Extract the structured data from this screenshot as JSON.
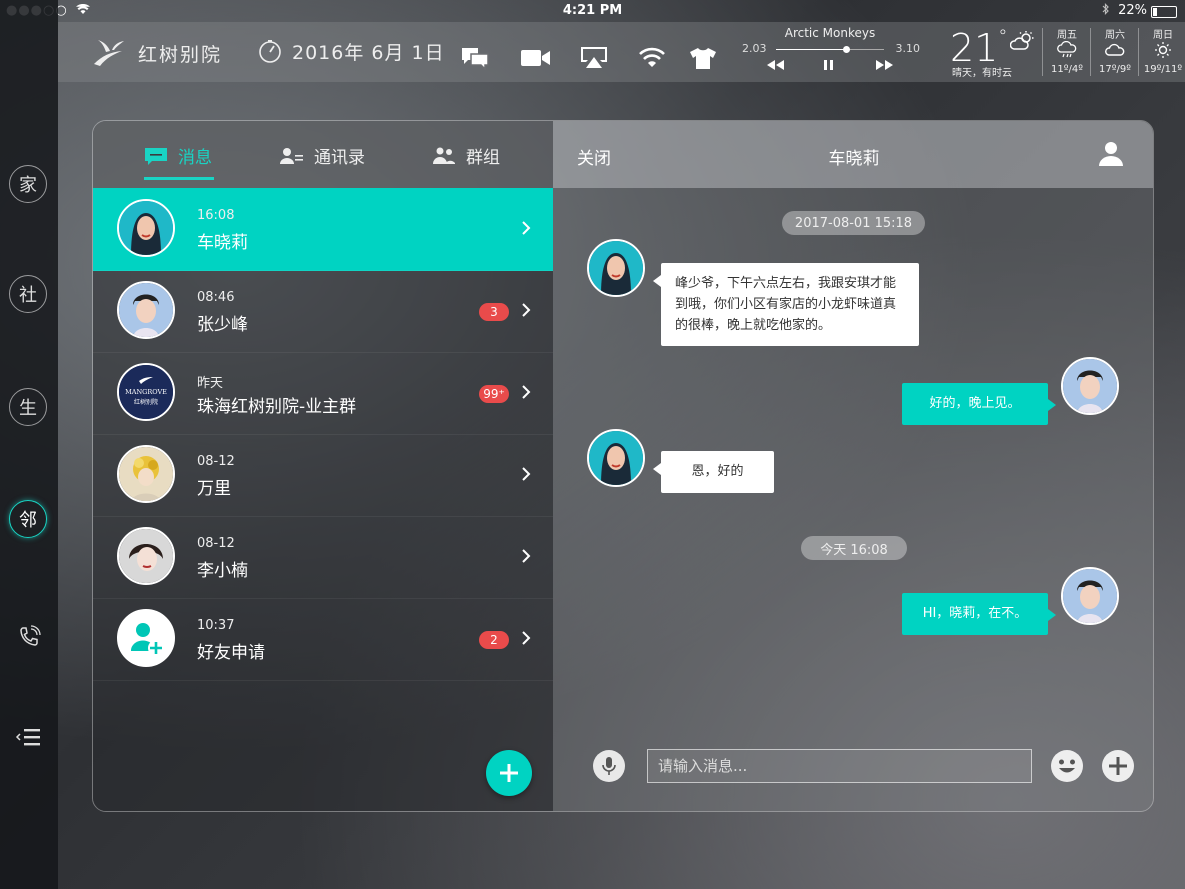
{
  "status_bar": {
    "carrier_dots": "●●●○○",
    "time": "4:21 PM",
    "battery_percent": "22%",
    "battery_level": 0.22
  },
  "rail": {
    "items": [
      {
        "label": "家"
      },
      {
        "label": "社"
      },
      {
        "label": "生"
      },
      {
        "label": "邻"
      }
    ],
    "active_index": 3
  },
  "header": {
    "logo_text": "红树别院",
    "date": "2016年 6月 1日",
    "music": {
      "title": "Arctic Monkeys",
      "elapsed": "2.03",
      "total": "3.10",
      "progress": 0.65
    },
    "weather": {
      "temp": "21",
      "description": "晴天，有时云",
      "forecast": [
        {
          "day": "周五",
          "temp": "11º/4º",
          "icon": "rain-cloud-icon"
        },
        {
          "day": "周六",
          "temp": "17º/9º",
          "icon": "cloud-icon"
        },
        {
          "day": "周日",
          "temp": "19º/11º",
          "icon": "sun-icon"
        }
      ]
    }
  },
  "tabs": [
    {
      "label": "消息",
      "icon": "chat-icon"
    },
    {
      "label": "通讯录",
      "icon": "contacts-icon"
    },
    {
      "label": "群组",
      "icon": "group-icon"
    }
  ],
  "conversations": [
    {
      "time": "16:08",
      "name": "车晓莉",
      "badge": "",
      "active": true
    },
    {
      "time": "08:46",
      "name": "张少峰",
      "badge": "3",
      "active": false
    },
    {
      "time": "昨天",
      "name": "珠海红树别院-业主群",
      "badge": "99⁺",
      "active": false
    },
    {
      "time": "08-12",
      "name": "万里",
      "badge": "",
      "active": false
    },
    {
      "time": "08-12",
      "name": "李小楠",
      "badge": "",
      "active": false
    },
    {
      "time": "10:37",
      "name": "好友申请",
      "badge": "2",
      "active": false
    }
  ],
  "group_avatar_text": {
    "line1": "MANGROVE",
    "line2": "红树别院"
  },
  "chat": {
    "close_label": "关闭",
    "title": "车晓莉",
    "timestamps": [
      "2017-08-01  15:18",
      "今天  16:08"
    ],
    "messages": [
      {
        "direction": "in",
        "text": "峰少爷，下午六点左右，我跟安琪才能到哦，你们小区有家店的小龙虾味道真的很棒，晚上就吃他家的。"
      },
      {
        "direction": "out",
        "text": "好的，晚上见。"
      },
      {
        "direction": "in",
        "text": "恩，好的"
      },
      {
        "direction": "out",
        "text": "HI，晓莉，在不。"
      }
    ],
    "input_placeholder": "请输入消息..."
  },
  "colors": {
    "accent": "#00d3c2",
    "badge": "#e94b4b"
  }
}
